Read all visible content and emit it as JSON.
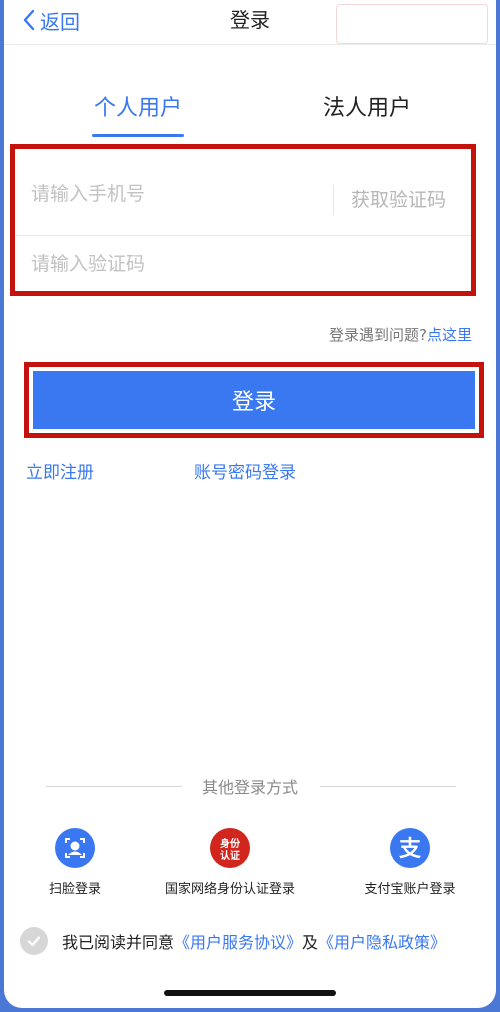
{
  "nav": {
    "back_label": "返回",
    "title": "登录"
  },
  "tabs": [
    {
      "label": "个人用户",
      "active": true
    },
    {
      "label": "法人用户",
      "active": false
    }
  ],
  "form": {
    "phone_placeholder": "请输入手机号",
    "get_code_label": "获取验证码",
    "code_placeholder": "请输入验证码"
  },
  "help": {
    "text": "登录遇到问题?",
    "link": "点这里"
  },
  "login_button": "登录",
  "links": {
    "register": "立即注册",
    "password_login": "账号密码登录"
  },
  "other_methods": {
    "title": "其他登录方式",
    "items": [
      {
        "label": "扫脸登录",
        "icon": "face-scan-icon"
      },
      {
        "label": "国家网络身份认证登录",
        "icon": "id-auth-icon",
        "badge_text": "身份认证"
      },
      {
        "label": "支付宝账户登录",
        "icon": "alipay-icon"
      }
    ]
  },
  "agreement": {
    "prefix": "我已阅读并同意",
    "service": "《用户服务协议》",
    "joiner": "及",
    "privacy": "《用户隐私政策》"
  },
  "colors": {
    "accent": "#3a78f2",
    "highlight": "#c4120c",
    "id_badge": "#d0261e",
    "frame": "#4a78d4"
  }
}
